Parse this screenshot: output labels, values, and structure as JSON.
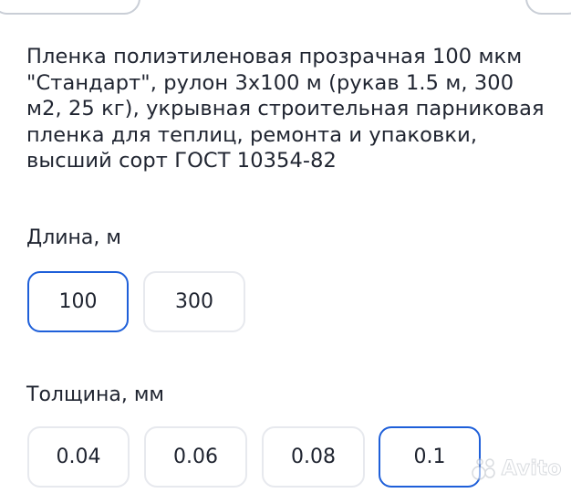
{
  "product": {
    "title": "Пленка полиэтиленовая прозрачная 100 мкм \"Стандарт\", рулон 3x100 м (рукав 1.5 м, 300 м2, 25 кг), укрывная строительная парниковая пленка для теплиц, ремонта и упаковки, высший сорт ГОСТ 10354-82"
  },
  "length": {
    "label": "Длина, м",
    "options": [
      {
        "value": "100",
        "selected": true
      },
      {
        "value": "300",
        "selected": false
      }
    ]
  },
  "thickness": {
    "label": "Толщина, мм",
    "options": [
      {
        "value": "0.04",
        "selected": false
      },
      {
        "value": "0.06",
        "selected": false
      },
      {
        "value": "0.08",
        "selected": false
      },
      {
        "value": "0.1",
        "selected": true
      }
    ]
  },
  "watermark": {
    "text": "Avito",
    "icon": "avito-logo-icon"
  },
  "colors": {
    "text": "#1f2430",
    "selected_border": "#1e5fd9",
    "option_border": "#e7e9ee",
    "background": "#ffffff"
  }
}
